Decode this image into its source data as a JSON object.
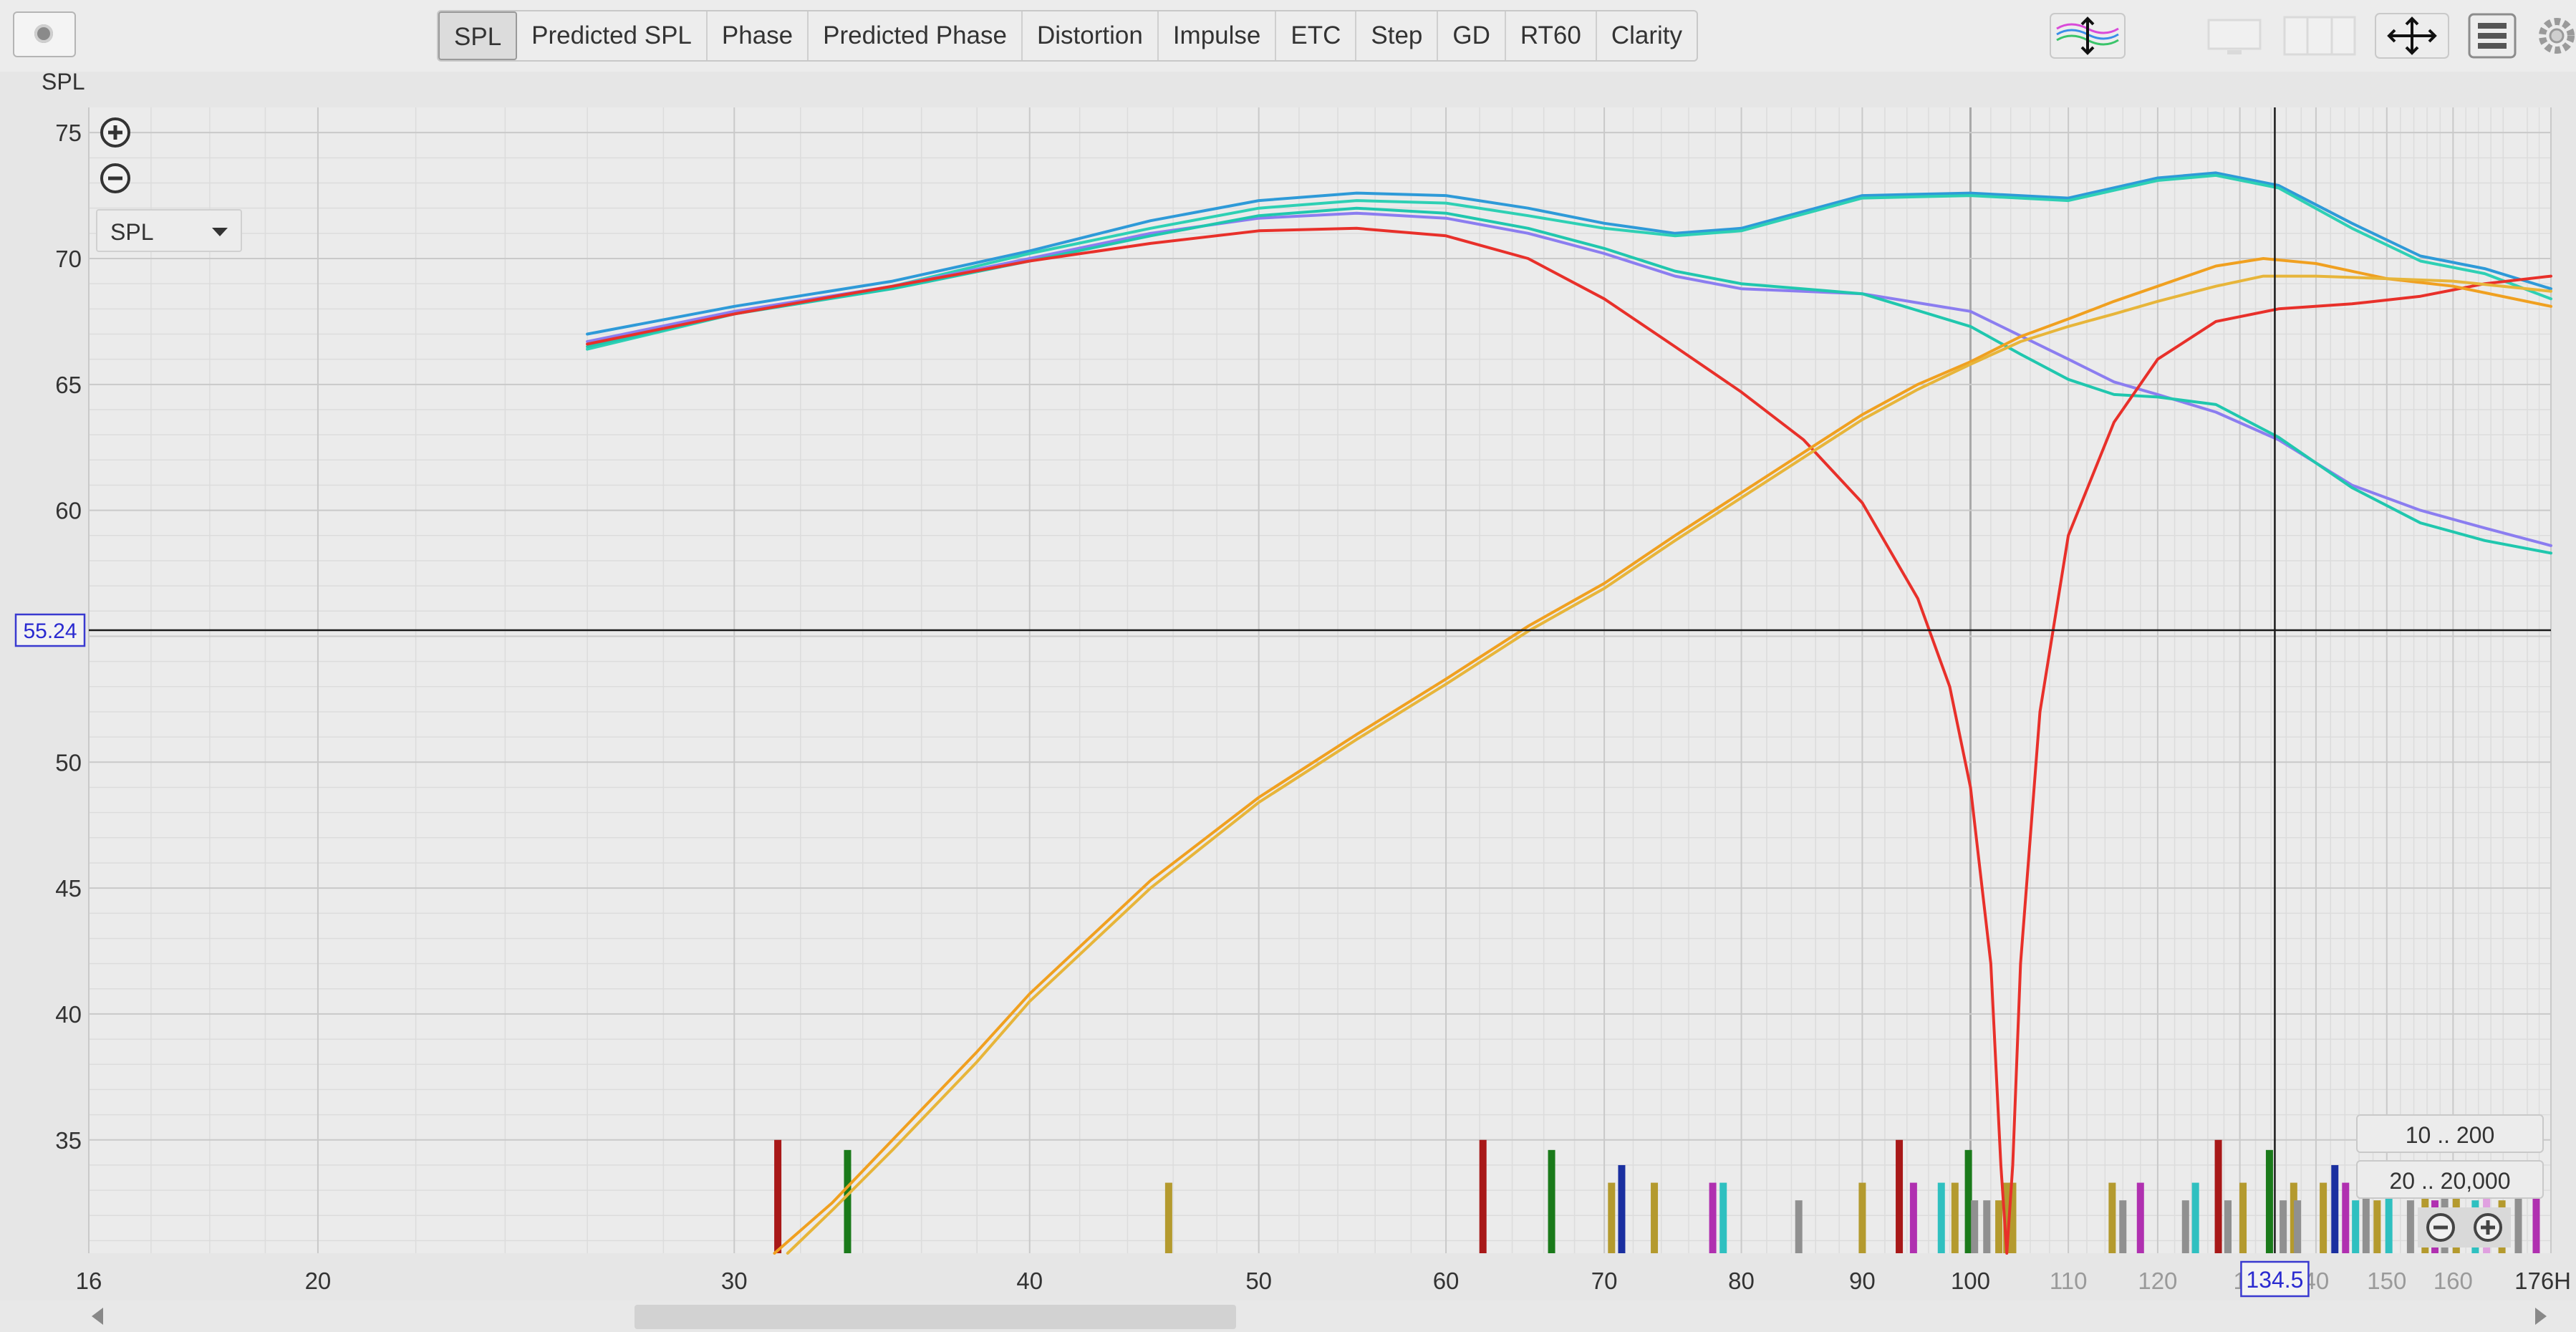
{
  "tabs": [
    "SPL",
    "Predicted SPL",
    "Phase",
    "Predicted Phase",
    "Distortion",
    "Impulse",
    "ETC",
    "Step",
    "GD",
    "RT60",
    "Clarity"
  ],
  "active_tab": "SPL",
  "y_axis_label": "SPL",
  "series_select": "SPL",
  "range_buttons": [
    "10 .. 200",
    "20 .. 20,000"
  ],
  "cursor": {
    "y_readout": "55.24",
    "x_readout": "134.5"
  },
  "chart_data": {
    "type": "line",
    "xscale": "log",
    "xlim": [
      16,
      176
    ],
    "ylim": [
      30.5,
      76
    ],
    "x_tick_labels": [
      "16",
      "20",
      "30",
      "40",
      "50",
      "60",
      "70",
      "80",
      "90",
      "100",
      "110",
      "120",
      "1",
      "40",
      "150",
      "160",
      "176H"
    ],
    "x_tick_values": [
      16,
      20,
      30,
      40,
      50,
      60,
      70,
      80,
      90,
      100,
      110,
      120,
      130,
      140,
      150,
      160,
      176
    ],
    "y_ticks": [
      35,
      40,
      45,
      50,
      55,
      60,
      65,
      70,
      75
    ],
    "grid": true,
    "cursor_x": 134.5,
    "cursor_y": 55.24,
    "series": [
      {
        "color": "#2e9ad8",
        "x": [
          26,
          30,
          35,
          40,
          45,
          50,
          55,
          60,
          65,
          70,
          75,
          80,
          90,
          100,
          110,
          120,
          127,
          135,
          145,
          155,
          165,
          176
        ],
        "y": [
          67.0,
          68.1,
          69.1,
          70.3,
          71.5,
          72.3,
          72.6,
          72.5,
          72.0,
          71.4,
          71.0,
          71.2,
          72.5,
          72.6,
          72.4,
          73.2,
          73.4,
          72.9,
          71.4,
          70.1,
          69.6,
          68.8
        ]
      },
      {
        "color": "#2ed0b4",
        "x": [
          26,
          30,
          35,
          40,
          45,
          50,
          55,
          60,
          65,
          70,
          75,
          80,
          90,
          100,
          110,
          120,
          127,
          135,
          145,
          155,
          165,
          176
        ],
        "y": [
          66.4,
          67.8,
          68.9,
          70.2,
          71.2,
          72.0,
          72.3,
          72.2,
          71.7,
          71.2,
          70.9,
          71.1,
          72.4,
          72.5,
          72.3,
          73.1,
          73.3,
          72.8,
          71.2,
          69.9,
          69.4,
          68.4
        ]
      },
      {
        "color": "#8b7df0",
        "x": [
          26,
          30,
          35,
          40,
          45,
          50,
          55,
          60,
          65,
          70,
          75,
          80,
          90,
          100,
          110,
          115,
          120,
          127,
          135,
          145,
          155,
          165,
          176
        ],
        "y": [
          66.7,
          67.9,
          68.9,
          70.0,
          71.0,
          71.6,
          71.8,
          71.6,
          71.0,
          70.2,
          69.3,
          68.8,
          68.6,
          67.9,
          66.0,
          65.1,
          64.6,
          63.9,
          62.8,
          61.0,
          60.0,
          59.3,
          58.6
        ]
      },
      {
        "color": "#20c7ae",
        "x": [
          26,
          30,
          35,
          40,
          45,
          50,
          55,
          60,
          65,
          70,
          75,
          80,
          90,
          100,
          105,
          110,
          115,
          120,
          127,
          135,
          145,
          155,
          165,
          176
        ],
        "y": [
          66.5,
          67.8,
          68.8,
          69.9,
          70.9,
          71.7,
          72.0,
          71.8,
          71.2,
          70.4,
          69.5,
          69.0,
          68.6,
          67.3,
          66.2,
          65.2,
          64.6,
          64.5,
          64.2,
          62.9,
          60.9,
          59.5,
          58.8,
          58.3
        ]
      },
      {
        "color": "#e8302a",
        "x": [
          26,
          30,
          35,
          40,
          45,
          50,
          55,
          60,
          65,
          70,
          75,
          80,
          85,
          90,
          95,
          98,
          100,
          102,
          103,
          103.6,
          104.2,
          105,
          107,
          110,
          115,
          120,
          127,
          135,
          145,
          155,
          165,
          176
        ],
        "y": [
          66.6,
          67.8,
          68.9,
          69.9,
          70.6,
          71.1,
          71.2,
          70.9,
          70.0,
          68.4,
          66.5,
          64.7,
          62.8,
          60.3,
          56.5,
          53.0,
          49.0,
          42.0,
          34.0,
          30.5,
          34.0,
          42.0,
          52.0,
          59.0,
          63.5,
          66.0,
          67.5,
          68.0,
          68.2,
          68.5,
          69.0,
          69.3
        ]
      },
      {
        "color": "#f0a020",
        "x": [
          31.2,
          33,
          35,
          38,
          40,
          45,
          50,
          55,
          60,
          65,
          70,
          75,
          80,
          85,
          90,
          95,
          100,
          105,
          110,
          115,
          120,
          127,
          133,
          140,
          150,
          160,
          176
        ],
        "y": [
          30.5,
          32.5,
          35.0,
          38.5,
          40.8,
          45.3,
          48.6,
          51.1,
          53.3,
          55.4,
          57.1,
          59.0,
          60.7,
          62.3,
          63.8,
          65.0,
          65.9,
          66.9,
          67.6,
          68.3,
          68.9,
          69.7,
          70.0,
          69.8,
          69.2,
          68.9,
          68.1
        ]
      },
      {
        "color": "#e7b53a",
        "x": [
          31.6,
          33,
          35,
          38,
          40,
          45,
          50,
          55,
          60,
          65,
          70,
          75,
          80,
          85,
          90,
          95,
          100,
          105,
          110,
          115,
          120,
          127,
          133,
          140,
          150,
          160,
          176
        ],
        "y": [
          30.5,
          32.2,
          34.6,
          38.1,
          40.5,
          45.0,
          48.4,
          50.9,
          53.1,
          55.2,
          56.9,
          58.8,
          60.5,
          62.1,
          63.6,
          64.8,
          65.8,
          66.7,
          67.3,
          67.8,
          68.3,
          68.9,
          69.3,
          69.3,
          69.2,
          69.1,
          68.7
        ]
      }
    ],
    "markers": {
      "x": [
        31.3,
        33.5,
        45.8,
        62.2,
        66.5,
        70.5,
        71.2,
        73.5,
        77.8,
        78.6,
        84.6,
        90.0,
        93.3,
        94.6,
        97.2,
        98.5,
        99.8,
        100.4,
        101.6,
        102.8,
        103.6,
        104.2,
        114.8,
        116.0,
        118.0,
        123.3,
        124.5,
        127.3,
        128.5,
        130.4,
        133.8,
        135.6,
        137.0,
        137.5,
        141.0,
        142.6,
        144.1,
        145.5,
        147.0,
        148.6,
        150.3,
        153.5,
        155.7,
        157.2,
        158.7,
        160.5,
        163.5,
        165.3,
        167.8,
        170.5,
        173.5
      ],
      "level": [
        35.0,
        34.6,
        33.3,
        35.0,
        34.6,
        33.3,
        34.0,
        33.3,
        33.3,
        33.3,
        32.6,
        33.3,
        35.0,
        33.3,
        33.3,
        33.3,
        34.6,
        32.6,
        32.6,
        32.6,
        33.3,
        33.3,
        33.3,
        32.6,
        33.3,
        32.6,
        33.3,
        35.0,
        32.6,
        33.3,
        34.6,
        32.6,
        33.3,
        32.6,
        33.3,
        34.0,
        33.3,
        32.6,
        33.3,
        32.6,
        33.3,
        32.6,
        33.3,
        32.6,
        33.3,
        33.3,
        32.6,
        33.3,
        32.6,
        33.3,
        33.3
      ],
      "color": [
        "#a81818",
        "#1a7a1a",
        "#b49a2e",
        "#a81818",
        "#1a7a1a",
        "#b49a2e",
        "#1a2fa0",
        "#b49a2e",
        "#b030b0",
        "#2fc0c0",
        "#909090",
        "#b49a2e",
        "#a81818",
        "#b030b0",
        "#2fc0c0",
        "#b49a2e",
        "#1a7a1a",
        "#909090",
        "#909090",
        "#b49a2e",
        "#b49a2e",
        "#b49a2e",
        "#b49a2e",
        "#909090",
        "#b030b0",
        "#909090",
        "#2fc0c0",
        "#a81818",
        "#909090",
        "#b49a2e",
        "#1a7a1a",
        "#909090",
        "#b49a2e",
        "#909090",
        "#b49a2e",
        "#1a2fa0",
        "#b030b0",
        "#2fc0c0",
        "#909090",
        "#b49a2e",
        "#2fc0c0",
        "#909090",
        "#b49a2e",
        "#b030b0",
        "#909090",
        "#b49a2e",
        "#2fc0c0",
        "#e0a0e0",
        "#b49a2e",
        "#909090",
        "#b030b0"
      ]
    }
  }
}
